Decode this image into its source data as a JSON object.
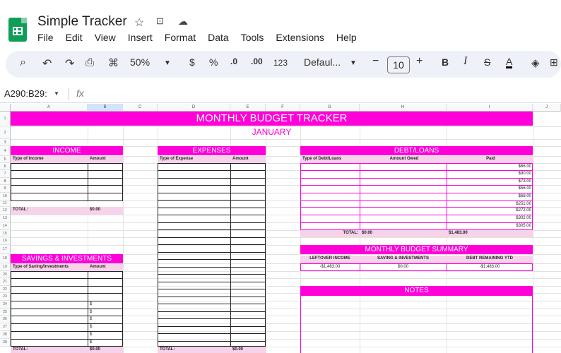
{
  "app": {
    "title": "Simple Tracker",
    "menu": [
      "File",
      "Edit",
      "View",
      "Insert",
      "Format",
      "Data",
      "Tools",
      "Extensions",
      "Help"
    ]
  },
  "toolbar": {
    "zoom": "50%",
    "currency": "$",
    "percent": "%",
    "dec_decrease": ".0",
    "dec_increase": ".00",
    "format_number": "123",
    "font": "Defaul...",
    "font_size": "10",
    "bold": "B",
    "italic": "I",
    "underline": "A"
  },
  "formula_bar": {
    "name_box": "A290:B29:",
    "fx": "fx"
  },
  "columns": [
    "A",
    "B",
    "C",
    "D",
    "E",
    "F",
    "G",
    "H",
    "I",
    "J"
  ],
  "rows": [
    "1",
    "2",
    "3",
    "4",
    "5",
    "6",
    "7",
    "8",
    "9",
    "10",
    "11",
    "12",
    "13",
    "14",
    "15",
    "16",
    "17",
    "18",
    "19",
    "20",
    "21",
    "22",
    "23",
    "24",
    "25",
    "26",
    "27",
    "28",
    "29"
  ],
  "sheet": {
    "title": "MONTHLY BUDGET TRACKER",
    "month": "JANUARY",
    "income": {
      "header": "INCOME",
      "col1": "Type of Income",
      "col2": "Amount",
      "total_label": "TOTAL:",
      "total": "$0.00"
    },
    "expenses": {
      "header": "EXPENSES",
      "col1": "Type of Expense",
      "col2": "Amount",
      "total_label": "TOTAL:",
      "total": "$0.00"
    },
    "savings": {
      "header": "SAVINGS  & INVESTMENTS",
      "col1": "Type of Saving/Investments",
      "col2": "Amount",
      "dollar": "$",
      "total_label": "TOTAL:",
      "total": "$0.00"
    },
    "debt": {
      "header": "DEBT/LOANS",
      "col1": "Type of Debt/Loans",
      "col2": "Amount Owed",
      "col3": "Paid",
      "paid": [
        "$66.00",
        "$90.00",
        "$73.00",
        "$56.00",
        "$68.00",
        "$251.00",
        "$272.00",
        "$302.00",
        "$305.00"
      ],
      "total_label": "TOTAL:",
      "total_owed": "$0.00",
      "total_paid": "$1,483.00"
    },
    "summary": {
      "header": "MONTHLY BUDGET SUMMARY",
      "col1": "LEFTOVER INCOME",
      "col2": "SAVING & INVESTMENTS",
      "col3": "DEBT REMAINING YTD",
      "val1": "-$1,483.00",
      "val2": "$0.00",
      "val3": "-$1,483.00"
    },
    "notes": {
      "header": "NOTES"
    }
  }
}
